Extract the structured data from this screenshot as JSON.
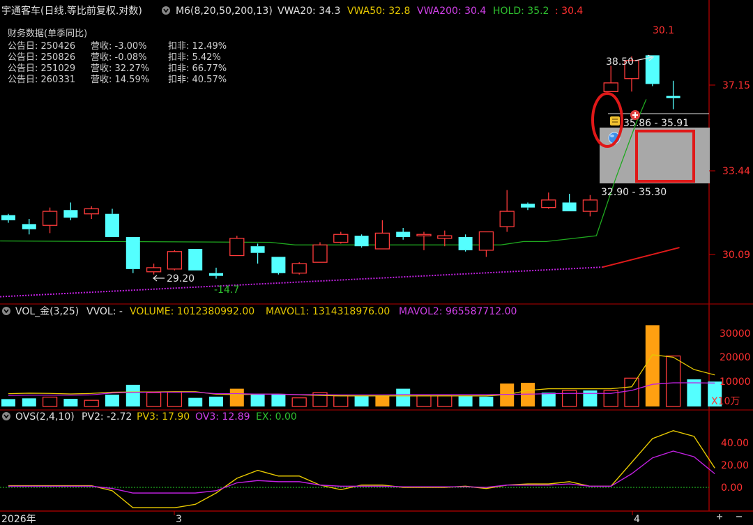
{
  "colors": {
    "up": "#ff3b3b",
    "down": "#54ffff",
    "orange": "#ffa011",
    "yellow": "#e6c800",
    "magenta": "#c020e0",
    "green": "#1fa81f",
    "red_line": "#e01a1a",
    "axis": "#cc0000",
    "text": "#d0d0d0"
  },
  "header": {
    "title": "宇通客车(日线.等比前复权.对数)",
    "ind": "M6(8,20,50,200,13)",
    "vwa20": "VWA20: 34.3",
    "vwa50": "VWA50: 32.8",
    "vwa200": "VWA200: 30.4",
    "hold": "HOLD: 35.2",
    "last": ": 30.4"
  },
  "fin": {
    "title": "财务数据(单季同比)",
    "rows": [
      {
        "label": "公告日: 250426",
        "rev": "营收: -3.00%",
        "np": "扣非: 12.49%"
      },
      {
        "label": "公告日: 250826",
        "rev": "营收: -0.08%",
        "np": "扣非: 5.42%"
      },
      {
        "label": "公告日: 251029",
        "rev": "营收: 32.27%",
        "np": "扣非: 66.77%"
      },
      {
        "label": "公告日: 260331",
        "rev": "营收: 14.59%",
        "np": "扣非: 40.57%"
      }
    ]
  },
  "annotations": {
    "top_value": "30.1",
    "high": "38.50",
    "zone1": "35.86 - 35.91",
    "zone2": "32.90 - 35.30",
    "low": "29.20",
    "low2": "-14.7"
  },
  "price_axis": {
    "ticks": [
      "37.15",
      "33.44",
      "30.09"
    ],
    "tick_values": [
      37.15,
      33.44,
      30.09
    ]
  },
  "vol_header": {
    "name": "VOL_金(3,25)",
    "vvol": "VVOL: -",
    "volume": "VOLUME: 1012380992.00",
    "mavol1": "MAVOL1: 1314318976.00",
    "mavol2": "MAVOL2: 965587712.00"
  },
  "vol_axis": {
    "ticks": [
      "30000",
      "20000",
      "10000"
    ],
    "tick_values": [
      30000,
      20000,
      10000
    ],
    "unit": "X10万"
  },
  "ovs_header": {
    "name": "OVS(2,4,10)",
    "pv2": "PV2: -2.72",
    "pv3": "PV3: 17.90",
    "ov3": "OV3: 12.89",
    "ex": "EX: 0.00"
  },
  "ovs_axis": {
    "ticks": [
      "40.00",
      "20.00",
      "0.00"
    ],
    "tick_values": [
      40,
      20,
      0
    ]
  },
  "date_axis": {
    "labels": [
      "2026年",
      "3",
      "4"
    ]
  },
  "chart_data": {
    "type": "candlestick",
    "price_scale": "log",
    "candles": [
      {
        "o": 31.6,
        "c": 31.4,
        "h": 31.65,
        "l": 31.3,
        "dir": "down"
      },
      {
        "o": 31.25,
        "c": 31.05,
        "h": 31.45,
        "l": 30.85,
        "dir": "down"
      },
      {
        "o": 31.2,
        "c": 31.75,
        "h": 31.9,
        "l": 30.9,
        "dir": "up"
      },
      {
        "o": 31.8,
        "c": 31.5,
        "h": 32.1,
        "l": 31.4,
        "dir": "down"
      },
      {
        "o": 31.65,
        "c": 31.85,
        "h": 31.95,
        "l": 31.45,
        "dir": "up"
      },
      {
        "o": 31.65,
        "c": 30.75,
        "h": 31.85,
        "l": 30.75,
        "dir": "down"
      },
      {
        "o": 30.75,
        "c": 29.55,
        "h": 30.75,
        "l": 29.4,
        "dir": "down"
      },
      {
        "o": 29.45,
        "c": 29.6,
        "h": 29.75,
        "l": 29.35,
        "dir": "up"
      },
      {
        "o": 29.55,
        "c": 30.2,
        "h": 30.25,
        "l": 29.5,
        "dir": "up"
      },
      {
        "o": 30.3,
        "c": 29.5,
        "h": 30.3,
        "l": 29.5,
        "dir": "down"
      },
      {
        "o": 29.4,
        "c": 29.3,
        "h": 29.6,
        "l": 29.2,
        "dir": "down"
      },
      {
        "o": 30.05,
        "c": 30.7,
        "h": 30.8,
        "l": 30.05,
        "dir": "up"
      },
      {
        "o": 30.4,
        "c": 30.15,
        "h": 30.5,
        "l": 29.75,
        "dir": "down"
      },
      {
        "o": 30.0,
        "c": 29.4,
        "h": 30.0,
        "l": 29.35,
        "dir": "down"
      },
      {
        "o": 29.4,
        "c": 29.75,
        "h": 29.8,
        "l": 29.35,
        "dir": "up"
      },
      {
        "o": 29.8,
        "c": 30.45,
        "h": 30.55,
        "l": 29.8,
        "dir": "up"
      },
      {
        "o": 30.55,
        "c": 30.85,
        "h": 30.95,
        "l": 30.5,
        "dir": "up"
      },
      {
        "o": 30.8,
        "c": 30.4,
        "h": 30.85,
        "l": 30.35,
        "dir": "down"
      },
      {
        "o": 30.3,
        "c": 30.9,
        "h": 31.4,
        "l": 30.3,
        "dir": "up"
      },
      {
        "o": 30.95,
        "c": 30.75,
        "h": 31.1,
        "l": 30.65,
        "dir": "down"
      },
      {
        "o": 30.85,
        "c": 30.85,
        "h": 30.95,
        "l": 30.25,
        "dir": "up"
      },
      {
        "o": 30.7,
        "c": 30.8,
        "h": 31.0,
        "l": 30.4,
        "dir": "up"
      },
      {
        "o": 30.75,
        "c": 30.25,
        "h": 30.85,
        "l": 30.2,
        "dir": "down"
      },
      {
        "o": 30.25,
        "c": 30.95,
        "h": 30.95,
        "l": 30.0,
        "dir": "up"
      },
      {
        "o": 31.15,
        "c": 31.75,
        "h": 32.6,
        "l": 30.95,
        "dir": "up"
      },
      {
        "o": 32.05,
        "c": 31.9,
        "h": 32.1,
        "l": 31.8,
        "dir": "down"
      },
      {
        "o": 31.9,
        "c": 32.2,
        "h": 32.5,
        "l": 31.85,
        "dir": "up"
      },
      {
        "o": 32.1,
        "c": 31.75,
        "h": 32.45,
        "l": 31.75,
        "dir": "down"
      },
      {
        "o": 31.75,
        "c": 32.2,
        "h": 32.4,
        "l": 31.55,
        "dir": "up"
      },
      {
        "o": 36.85,
        "c": 37.25,
        "h": 38.05,
        "l": 36.85,
        "dir": "up"
      },
      {
        "o": 37.45,
        "c": 38.3,
        "h": 38.5,
        "l": 36.85,
        "dir": "up"
      },
      {
        "o": 38.55,
        "c": 37.2,
        "h": 38.55,
        "l": 37.1,
        "dir": "down"
      },
      {
        "o": 36.65,
        "c": 36.55,
        "h": 37.35,
        "l": 36.05,
        "dir": "down"
      }
    ],
    "hold_line": [
      {
        "i": -0.4,
        "v": 30.6
      },
      {
        "i": 12.6,
        "v": 30.55
      },
      {
        "i": 13.8,
        "v": 30.45
      },
      {
        "i": 23.7,
        "v": 30.45
      },
      {
        "i": 24.8,
        "v": 30.58
      },
      {
        "i": 25.9,
        "v": 30.58
      },
      {
        "i": 28.3,
        "v": 30.8
      },
      {
        "i": 29.2,
        "v": 33.0
      },
      {
        "i": 30.2,
        "v": 35.4
      },
      {
        "i": 30.7,
        "v": 36.5
      }
    ],
    "vwa200_line": {
      "start_i": -0.4,
      "start_v": 28.55,
      "mid_i": 28.6,
      "mid_v": 29.62,
      "end_i": 32.3,
      "end_v": 30.35
    },
    "volume": {
      "values": [
        3000,
        3300,
        3800,
        3100,
        2500,
        4800,
        8800,
        5600,
        5800,
        3500,
        4000,
        7200,
        5000,
        5000,
        3500,
        5600,
        4300,
        4300,
        4300,
        7200,
        4300,
        4300,
        4300,
        4000,
        9300,
        9600,
        5600,
        6500,
        6500,
        6500,
        11500,
        33000,
        20500,
        11000,
        10100
      ],
      "colors": [
        "down",
        "down",
        "up",
        "down",
        "up",
        "down",
        "down",
        "up",
        "up",
        "down",
        "down",
        "orange",
        "down",
        "down",
        "up",
        "up",
        "up",
        "down",
        "orange",
        "down",
        "up",
        "up",
        "down",
        "down",
        "orange",
        "orange",
        "down",
        "up",
        "down",
        "up",
        "up",
        "orange",
        "up",
        "down",
        "down"
      ],
      "mavol1": [
        5200,
        5400,
        5300,
        5100,
        5300,
        5800,
        5900,
        5900,
        6000,
        6000,
        5000,
        4800,
        5000,
        5000,
        4700,
        4500,
        4300,
        4300,
        4300,
        4300,
        4300,
        4300,
        4300,
        4300,
        4800,
        6500,
        7200,
        7200,
        7200,
        7200,
        8000,
        21000,
        20000,
        15000,
        12800
      ],
      "mavol2": [
        4500,
        4600,
        4600,
        4600,
        4700,
        5500,
        5700,
        5800,
        5800,
        5800,
        5200,
        5200,
        5000,
        5000,
        4800,
        4800,
        4700,
        4700,
        4700,
        4800,
        4800,
        4800,
        4800,
        4800,
        4900,
        5000,
        5200,
        5300,
        5300,
        5300,
        6500,
        9000,
        9600,
        9600,
        9500
      ]
    },
    "ovs": {
      "pv3": [
        1.5,
        1.5,
        1.5,
        1.5,
        1.5,
        -3,
        -18,
        -18,
        -18,
        -15,
        -5,
        8,
        15,
        10,
        10,
        2,
        -2,
        2,
        2,
        0,
        0,
        0,
        1,
        -1,
        2,
        3,
        3,
        5,
        1,
        1,
        22,
        43,
        50,
        45,
        17
      ],
      "ov3": [
        1,
        1,
        1,
        1,
        1,
        -1,
        -5,
        -5,
        -5,
        -5,
        -3,
        4,
        6,
        5,
        5,
        2,
        1,
        1,
        1,
        0.5,
        0.5,
        0.5,
        0.5,
        0,
        2,
        2,
        2,
        3,
        1,
        1,
        12,
        26,
        32,
        27,
        12
      ]
    }
  }
}
